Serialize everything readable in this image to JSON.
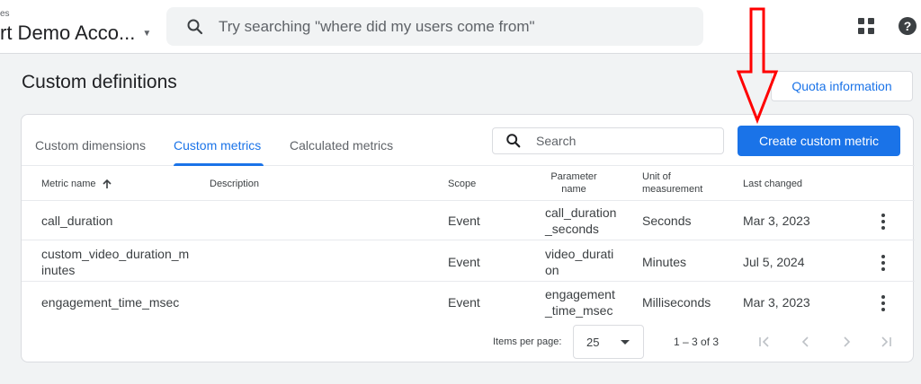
{
  "header": {
    "breadcrumb": "es",
    "account_name": "rt Demo Acco...",
    "search_placeholder": "Try searching \"where did my users come from\"",
    "apps_icon": "apps-grid-icon",
    "help_icon": "help-icon",
    "help_glyph": "?"
  },
  "page": {
    "title": "Custom definitions",
    "quota_button": "Quota information"
  },
  "tabs": [
    {
      "label": "Custom dimensions",
      "active": false
    },
    {
      "label": "Custom metrics",
      "active": true
    },
    {
      "label": "Calculated metrics",
      "active": false
    }
  ],
  "toolbar": {
    "search_placeholder": "Search",
    "create_button": "Create custom metric"
  },
  "table": {
    "headers": {
      "metric_name": "Metric name",
      "description": "Description",
      "scope": "Scope",
      "parameter_name_l1": "Parameter",
      "parameter_name_l2": "name",
      "unit_l1": "Unit of",
      "unit_l2": "measurement",
      "last_changed": "Last changed"
    },
    "sort_icon": "arrow-up-icon",
    "rows": [
      {
        "name_l1": "call_duration",
        "name_l2": "",
        "scope": "Event",
        "param_l1": "call_duration",
        "param_l2": "_seconds",
        "unit": "Seconds",
        "changed": "Mar 3, 2023"
      },
      {
        "name_l1": "custom_video_duration_m",
        "name_l2": "inutes",
        "scope": "Event",
        "param_l1": "video_durati",
        "param_l2": "on",
        "unit": "Minutes",
        "changed": "Jul 5, 2024"
      },
      {
        "name_l1": "engagement_time_msec",
        "name_l2": "",
        "scope": "Event",
        "param_l1": "engagement",
        "param_l2": "_time_msec",
        "unit": "Milliseconds",
        "changed": "Mar 3, 2023"
      }
    ]
  },
  "footer": {
    "items_per_page_label": "Items per page:",
    "items_per_page_value": "25",
    "range": "1 – 3 of 3"
  },
  "colors": {
    "primary": "#1a73e8",
    "annotation": "#ff0000"
  }
}
